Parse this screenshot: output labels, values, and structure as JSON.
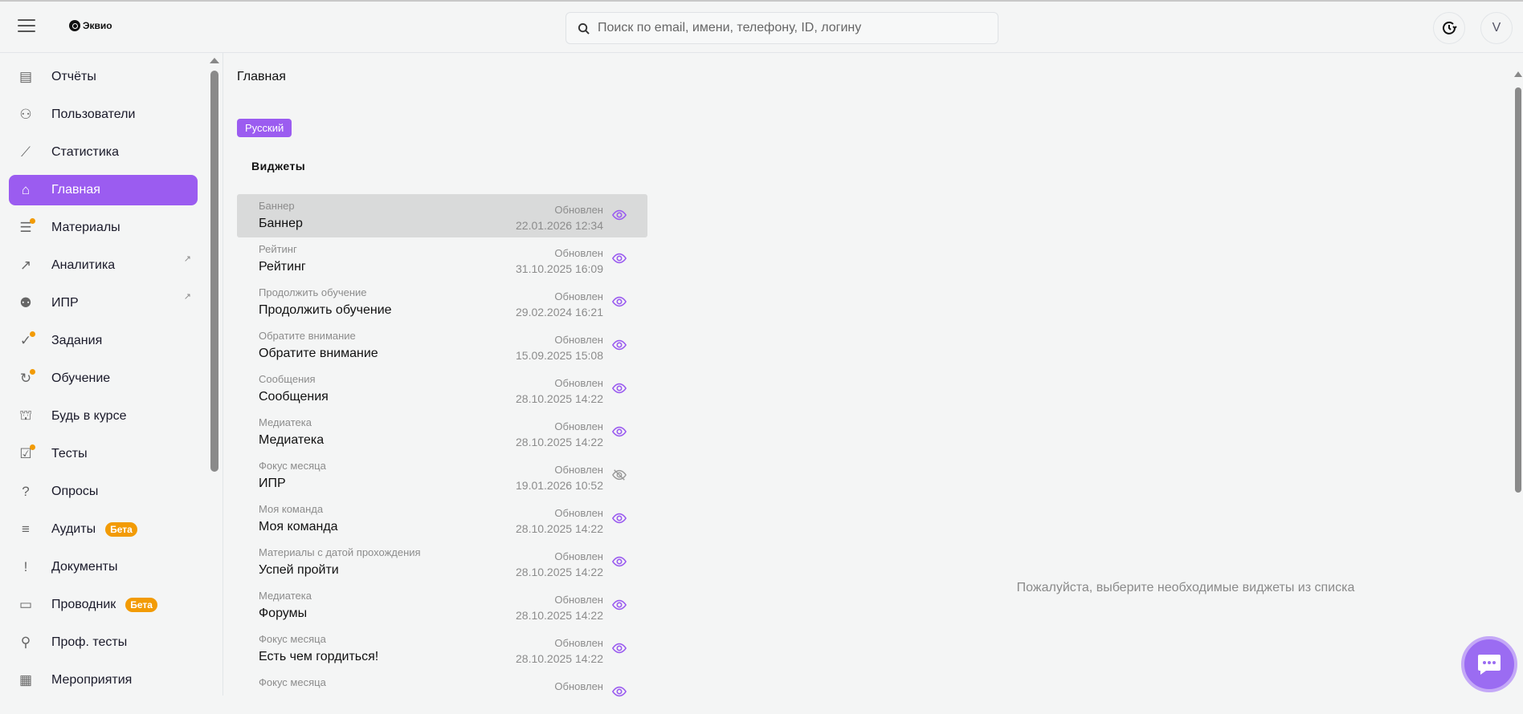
{
  "header": {
    "logo_text": "Эквио",
    "search_placeholder": "Поиск по email, имени, телефону, ID, логину",
    "avatar_initial": "V"
  },
  "sidebar": {
    "items": [
      {
        "label": "Отчёты",
        "icon": "report-icon"
      },
      {
        "label": "Пользователи",
        "icon": "users-icon"
      },
      {
        "label": "Статистика",
        "icon": "chart-line-icon"
      },
      {
        "label": "Главная",
        "icon": "home-icon",
        "active": true
      },
      {
        "label": "Материалы",
        "icon": "materials-icon",
        "dot": true
      },
      {
        "label": "Аналитика",
        "icon": "external-link-icon",
        "external": true
      },
      {
        "label": "ИПР",
        "icon": "team-icon",
        "external": true
      },
      {
        "label": "Задания",
        "icon": "check-circle-icon",
        "dot": true
      },
      {
        "label": "Обучение",
        "icon": "learning-icon",
        "dot": true
      },
      {
        "label": "Будь в курсе",
        "icon": "graduation-cap-icon"
      },
      {
        "label": "Тесты",
        "icon": "tests-icon",
        "dot": true
      },
      {
        "label": "Опросы",
        "icon": "question-bubble-icon"
      },
      {
        "label": "Аудиты",
        "icon": "audit-icon",
        "badge": "Бета"
      },
      {
        "label": "Документы",
        "icon": "alert-circle-icon"
      },
      {
        "label": "Проводник",
        "icon": "folder-icon",
        "badge": "Бета"
      },
      {
        "label": "Проф. тесты",
        "icon": "user-check-icon"
      },
      {
        "label": "Мероприятия",
        "icon": "calendar-icon"
      }
    ]
  },
  "main": {
    "breadcrumb": "Главная",
    "language": "Русский",
    "widgets_title": "Виджеты",
    "empty_text": "Пожалуйста, выберите необходимые виджеты из списка",
    "widgets": [
      {
        "type": "Баннер",
        "name": "Баннер",
        "status": "Обновлен",
        "date": "22.01.2026 12:34",
        "visible": true
      },
      {
        "type": "Рейтинг",
        "name": "Рейтинг",
        "status": "Обновлен",
        "date": "31.10.2025 16:09",
        "visible": true
      },
      {
        "type": "Продолжить обучение",
        "name": "Продолжить обучение",
        "status": "Обновлен",
        "date": "29.02.2024 16:21",
        "visible": true
      },
      {
        "type": "Обратите внимание",
        "name": "Обратите внимание",
        "status": "Обновлен",
        "date": "15.09.2025 15:08",
        "visible": true
      },
      {
        "type": "Сообщения",
        "name": "Сообщения",
        "status": "Обновлен",
        "date": "28.10.2025 14:22",
        "visible": true
      },
      {
        "type": "Медиатека",
        "name": "Медиатека",
        "status": "Обновлен",
        "date": "28.10.2025 14:22",
        "visible": true
      },
      {
        "type": "Фокус месяца",
        "name": "ИПР",
        "status": "Обновлен",
        "date": "19.01.2026 10:52",
        "visible": false
      },
      {
        "type": "Моя команда",
        "name": "Моя команда",
        "status": "Обновлен",
        "date": "28.10.2025 14:22",
        "visible": true
      },
      {
        "type": "Материалы с датой прохождения",
        "name": "Успей пройти",
        "status": "Обновлен",
        "date": "28.10.2025 14:22",
        "visible": true
      },
      {
        "type": "Медиатека",
        "name": "Форумы",
        "status": "Обновлен",
        "date": "28.10.2025 14:22",
        "visible": true
      },
      {
        "type": "Фокус месяца",
        "name": "Есть чем гордиться!",
        "status": "Обновлен",
        "date": "28.10.2025 14:22",
        "visible": true
      },
      {
        "type": "Фокус месяца",
        "name": "",
        "status": "Обновлен",
        "date": "",
        "visible": true
      }
    ]
  },
  "colors": {
    "accent": "#9b5cf0",
    "badge": "#f29b05"
  }
}
